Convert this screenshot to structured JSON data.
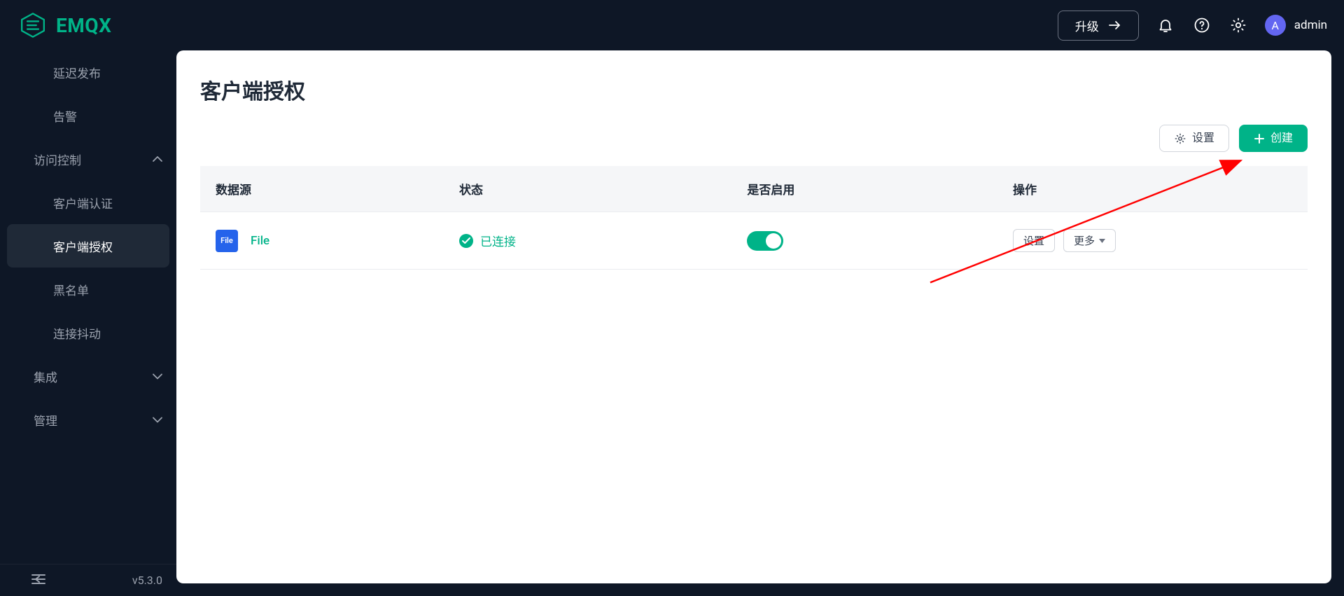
{
  "brand": "EMQX",
  "version": "v5.3.0",
  "header": {
    "upgrade_label": "升级",
    "user": {
      "initial": "A",
      "name": "admin"
    }
  },
  "sidebar": {
    "items": [
      {
        "label": "延迟发布",
        "type": "sub"
      },
      {
        "label": "告警",
        "type": "sub"
      },
      {
        "label": "访问控制",
        "type": "group",
        "expanded": true
      },
      {
        "label": "客户端认证",
        "type": "sub"
      },
      {
        "label": "客户端授权",
        "type": "sub",
        "active": true
      },
      {
        "label": "黑名单",
        "type": "sub"
      },
      {
        "label": "连接抖动",
        "type": "sub"
      },
      {
        "label": "集成",
        "type": "group",
        "expanded": false
      },
      {
        "label": "管理",
        "type": "group",
        "expanded": false
      }
    ]
  },
  "page": {
    "title": "客户端授权",
    "toolbar": {
      "settings_label": "设置",
      "create_label": "创建"
    },
    "table": {
      "columns": {
        "source": "数据源",
        "status": "状态",
        "enabled": "是否启用",
        "ops": "操作"
      },
      "rows": [
        {
          "source_icon_text": "File",
          "source_name": "File",
          "status_text": "已连接",
          "enabled": true,
          "actions": {
            "settings": "设置",
            "more": "更多"
          }
        }
      ]
    }
  },
  "colors": {
    "accent": "#00b388",
    "bg_dark": "#0e1726",
    "file_icon_bg": "#2563eb",
    "avatar_bg": "#6366f1"
  }
}
